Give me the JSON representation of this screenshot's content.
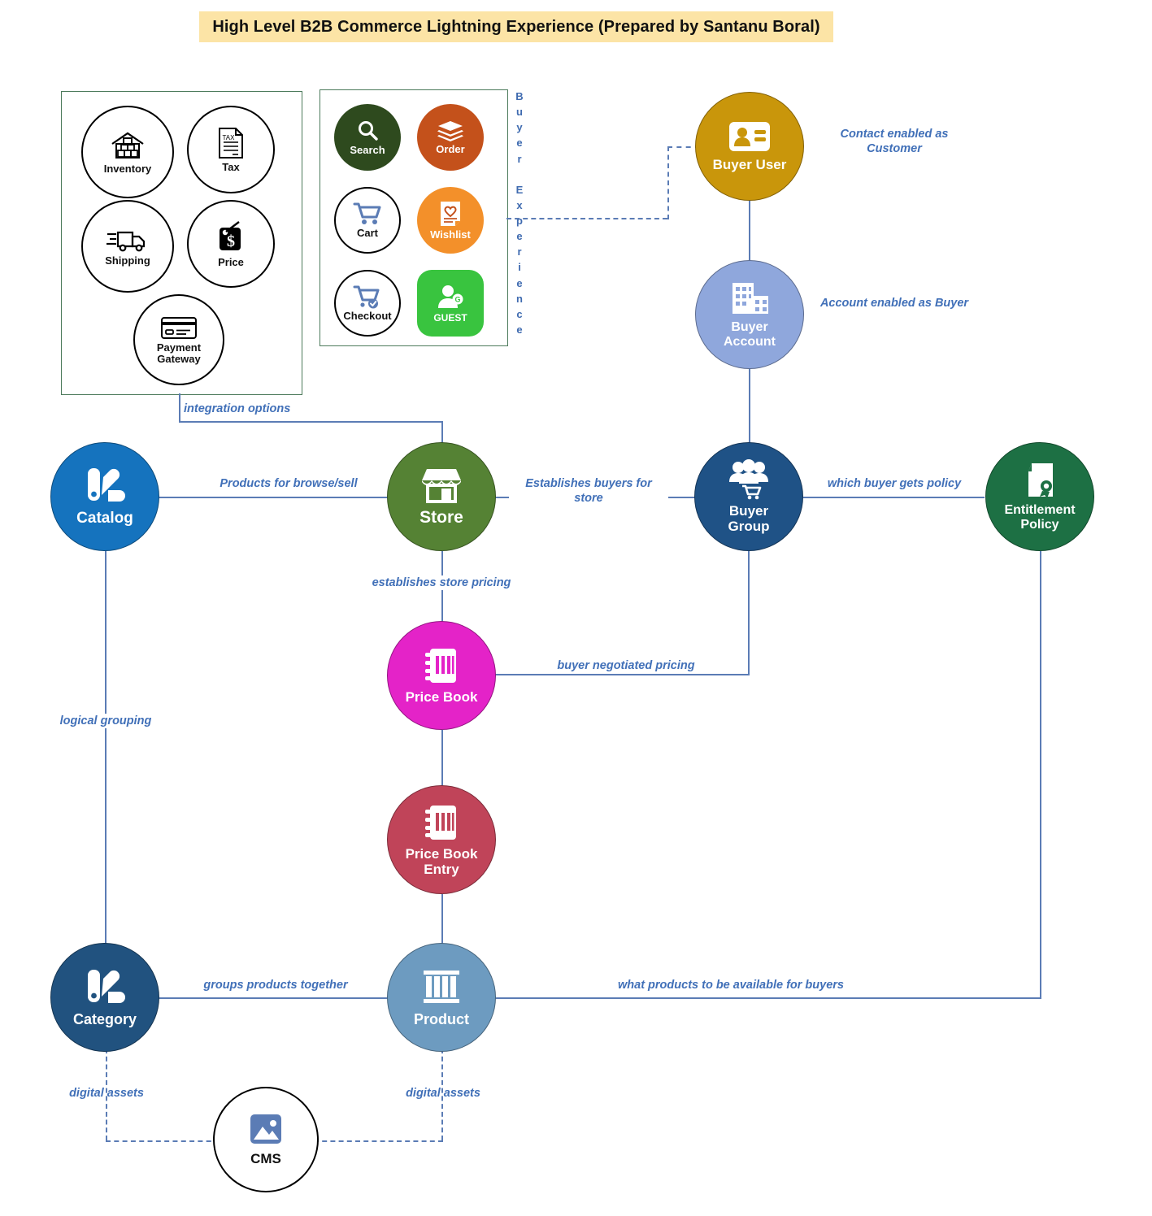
{
  "page": {
    "title": "High Level B2B Commerce Lightning Experience (Prepared by Santanu Boral)",
    "title_band_color": "#FCE4A6"
  },
  "colors": {
    "connector": "#5B7CB5",
    "edge_label": "#4170B8",
    "group_border": "#4C7A5B"
  },
  "groups": {
    "integration": {
      "name": "integration-options-group",
      "items": [
        {
          "label": "Inventory",
          "icon": "warehouse-inventory-icon",
          "style": "outline"
        },
        {
          "label": "Tax",
          "icon": "tax-document-icon",
          "style": "outline"
        },
        {
          "label": "Shipping",
          "icon": "delivery-truck-icon",
          "style": "outline"
        },
        {
          "label": "Price",
          "icon": "price-tag-dollar-icon",
          "style": "outline"
        },
        {
          "label": "Payment Gateway",
          "icon": "credit-card-icon",
          "style": "outline"
        }
      ]
    },
    "buyer_experience": {
      "name": "buyer-experience-group",
      "vertical_label": "Buyer Experience",
      "items": [
        {
          "label": "Search",
          "icon": "magnifier-search-icon",
          "style": "filled",
          "color": "#2E4A1E"
        },
        {
          "label": "Order",
          "icon": "stacked-layers-icon",
          "style": "filled",
          "color": "#C4511B"
        },
        {
          "label": "Cart",
          "icon": "shopping-cart-icon",
          "style": "outline",
          "color": "#5B7CB5"
        },
        {
          "label": "Wishlist",
          "icon": "wishlist-heart-page-icon",
          "style": "filled",
          "color": "#F3902A"
        },
        {
          "label": "Checkout",
          "icon": "cart-check-icon",
          "style": "outline",
          "color": "#5B7CB5"
        },
        {
          "label": "GUEST",
          "icon": "guest-user-icon",
          "style": "filled",
          "color": "#39C43F"
        }
      ]
    }
  },
  "nodes": [
    {
      "id": "buyer_user",
      "label": "Buyer User",
      "icon": "id-badge-contact-icon",
      "color": "#C9960B"
    },
    {
      "id": "buyer_account",
      "label": "Buyer Account",
      "icon": "office-building-icon",
      "color": "#8FA7DC"
    },
    {
      "id": "catalog",
      "label": "Catalog",
      "icon": "color-swatch-icon",
      "color": "#1573BE"
    },
    {
      "id": "store",
      "label": "Store",
      "icon": "storefront-icon",
      "color": "#558234"
    },
    {
      "id": "buyer_group",
      "label": "Buyer Group",
      "icon": "people-cart-group-icon",
      "color": "#1F5286"
    },
    {
      "id": "entitlement_policy",
      "label": "Entitlement Policy",
      "icon": "certificate-document-icon",
      "color": "#1D7044"
    },
    {
      "id": "price_book",
      "label": "Price Book",
      "icon": "price-book-icon",
      "color": "#E423C8"
    },
    {
      "id": "price_book_entry",
      "label": "Price Book Entry",
      "icon": "price-book-icon",
      "color": "#C04459"
    },
    {
      "id": "category",
      "label": "Category",
      "icon": "color-swatch-icon",
      "color": "#21527F"
    },
    {
      "id": "product",
      "label": "Product",
      "icon": "product-columns-icon",
      "color": "#6D9BC0"
    },
    {
      "id": "cms",
      "label": "CMS",
      "icon": "image-picture-icon",
      "color": "#FFFFFF"
    }
  ],
  "edge_labels": {
    "contact_enabled": "Contact enabled as Customer",
    "account_enabled": "Account enabled as Buyer",
    "integration_options": "integration options",
    "products_browse_sell": "Products for browse/sell",
    "establishes_buyers": "Establishes buyers for store",
    "which_buyer_policy": "which buyer gets policy",
    "establishes_store_pricing": "establishes store pricing",
    "buyer_negotiated_pricing": "buyer negotiated pricing",
    "logical_grouping": "logical grouping",
    "groups_products": "groups products together",
    "what_products": "what products to be available for buyers",
    "digital_assets_left": "digital assets",
    "digital_assets_right": "digital assets"
  }
}
